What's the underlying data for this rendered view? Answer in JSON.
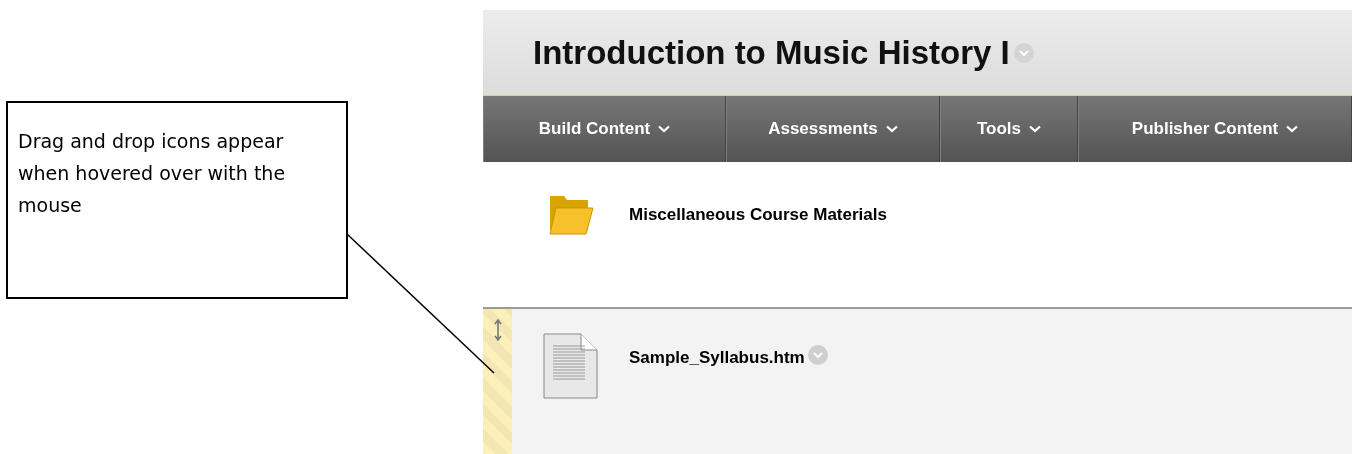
{
  "callout": {
    "text": "Drag and drop icons appear when hovered over with the mouse"
  },
  "course": {
    "title": "Introduction to Music History I"
  },
  "menu": [
    {
      "label": "Build Content"
    },
    {
      "label": "Assessments"
    },
    {
      "label": "Tools"
    },
    {
      "label": "Publisher Content"
    }
  ],
  "items": [
    {
      "kind": "folder",
      "title": "Miscellaneous Course Materials",
      "hovered": false,
      "menu_button": false
    },
    {
      "kind": "document",
      "title": "Sample_Syllabus.htm",
      "hovered": true,
      "menu_button": true
    }
  ]
}
